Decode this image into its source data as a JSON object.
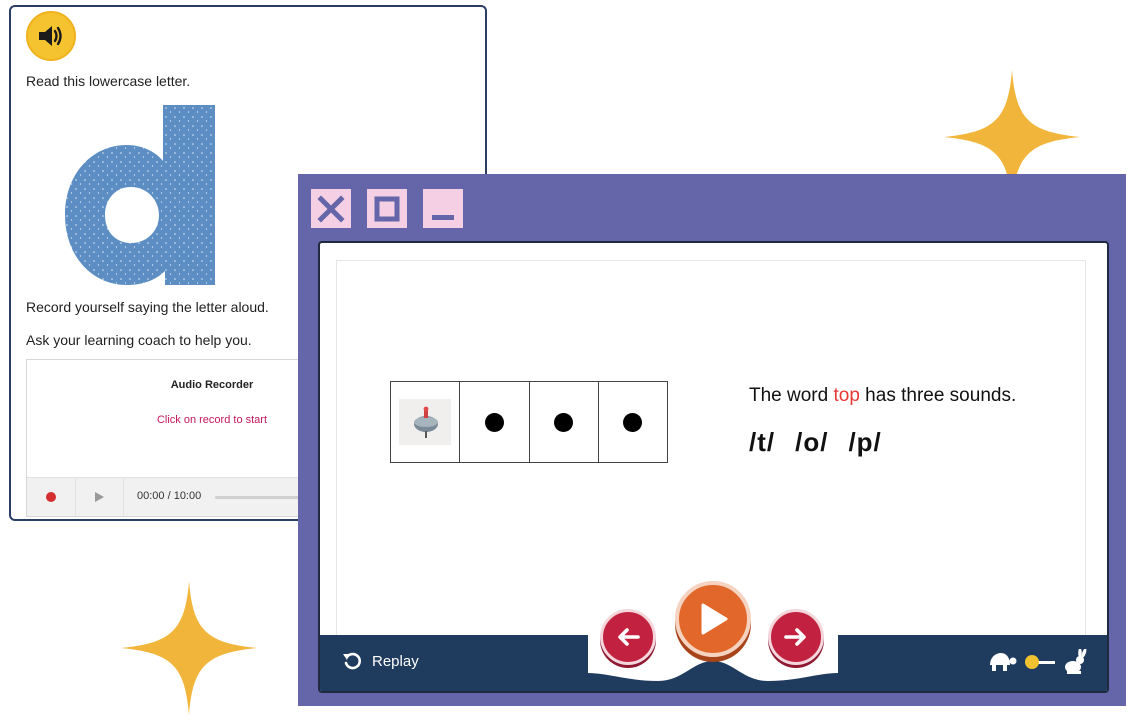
{
  "letter_card": {
    "letter": "d",
    "read_prompt": "Read this lowercase letter.",
    "record_prompt": "Record yourself saying the letter aloud.",
    "coach_prompt": "Ask your learning coach to help you.",
    "recorder": {
      "title": "Audio Recorder",
      "hint": "Click on record to start",
      "time": "00:00 / 10:00"
    }
  },
  "lesson_window": {
    "sentence_pre": "The word ",
    "sentence_word": "top",
    "sentence_post": " has three sounds.",
    "phonemes": [
      "/t/",
      "/o/",
      "/p/"
    ],
    "sound_box_count": 3,
    "replay_label": "Replay",
    "speed_level": 0
  },
  "colors": {
    "window_frame": "#6466a9",
    "window_button": "#f5cfe3",
    "bottom_bar": "#1f3c5e",
    "play_button": "#e2672a",
    "nav_button": "#c2213f",
    "highlight_word": "#e53935",
    "star": "#f2b53b",
    "letter_blue": "#5c8ec4"
  },
  "icons": {
    "speaker": "speaker-icon",
    "close": "close-icon",
    "maximize": "maximize-icon",
    "minimize": "minimize-icon",
    "replay": "replay-icon",
    "play": "play-icon",
    "back": "arrow-left-icon",
    "forward": "arrow-right-icon",
    "slow": "turtle-icon",
    "fast": "rabbit-icon",
    "record": "record-icon"
  }
}
